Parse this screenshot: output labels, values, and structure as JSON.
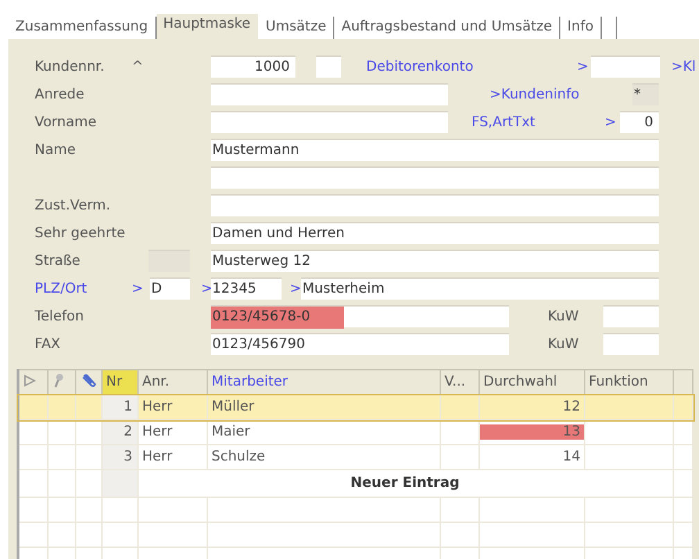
{
  "tabs": [
    {
      "label": "Zusammenfassung",
      "selected": false
    },
    {
      "label": "Hauptmaske",
      "selected": true
    },
    {
      "label": "Umsätze",
      "selected": false
    },
    {
      "label": "Auftragsbestand und Umsätze",
      "selected": false
    },
    {
      "label": "Info",
      "selected": false
    }
  ],
  "form": {
    "rows": [
      {
        "kind": "customer",
        "label": "Kundennr.",
        "sort_mark": "^",
        "value": "1000",
        "link": "Debitorenkonto",
        "link_arrow": ">",
        "link_extra": ">Kl"
      },
      {
        "kind": "info",
        "label": "Anrede",
        "link": ">Kundeninfo",
        "flag": "*"
      },
      {
        "kind": "category",
        "label": "Vorname",
        "link": "FS,ArtTxt",
        "link_arrow": ">",
        "side_value": "0"
      },
      {
        "kind": "wide",
        "label": "Name",
        "value": "Mustermann"
      },
      {
        "kind": "wide"
      },
      {
        "kind": "wide",
        "label": "Zust.Verm."
      },
      {
        "kind": "wide",
        "label": "Sehr geehrte",
        "value": " Damen und Herren"
      },
      {
        "kind": "street",
        "label": "Straße",
        "value": "Musterweg 12"
      },
      {
        "kind": "address",
        "label": "PLZ/Ort",
        "country_arrow": ">",
        "country": "D",
        "zip_arrow": ">",
        "zip": "12345",
        "city_arrow": ">",
        "city": "Musterheim"
      },
      {
        "kind": "phone",
        "label": "Telefon",
        "value": "0123/45678-0",
        "highlight": true,
        "extra_label": "KuW"
      },
      {
        "kind": "phone",
        "label": "FAX",
        "value": "0123/456790",
        "highlight": false,
        "extra_label": "KuW"
      }
    ]
  },
  "grid": {
    "columns": [
      {
        "label": "Nr",
        "highlight": true,
        "link": false
      },
      {
        "label": "Anr.",
        "highlight": false,
        "link": false
      },
      {
        "label": "Mitarbeiter",
        "highlight": false,
        "link": true
      },
      {
        "label": "V...",
        "highlight": false,
        "link": false
      },
      {
        "label": "Durchwahl",
        "highlight": false,
        "link": false
      },
      {
        "label": "Funktion",
        "highlight": false,
        "link": false
      }
    ],
    "rows": [
      {
        "nr": "1",
        "salutation": "Herr",
        "name": "Müller",
        "extension": "12",
        "extension_flag": false,
        "selected": true
      },
      {
        "nr": "2",
        "salutation": "Herr",
        "name": "Maier",
        "extension": "13",
        "extension_flag": true,
        "selected": false
      },
      {
        "nr": "3",
        "salutation": "Herr",
        "name": "Schulze",
        "extension": "14",
        "extension_flag": false,
        "selected": false
      }
    ],
    "new_entry": "Neuer Eintrag"
  }
}
